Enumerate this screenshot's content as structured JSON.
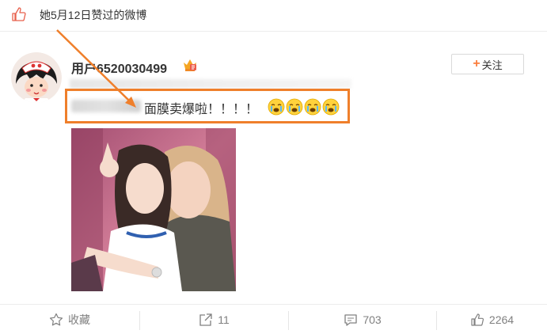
{
  "liked_notice": {
    "text": "她5月12日赞过的微博",
    "icon": "thumbs-up-icon"
  },
  "post": {
    "username": "用户6520030499",
    "badge_icon": "vip-crown-icon",
    "follow_label": "关注",
    "follow_icon": "plus-icon",
    "text": "面膜卖爆啦！！！！",
    "emoji_icons": [
      "crying-face-icon",
      "crying-face-icon",
      "crying-face-icon",
      "crying-face-icon"
    ],
    "highlight_color": "#ef7f2b"
  },
  "actions": {
    "favorite": {
      "label": "收藏",
      "icon": "star-icon"
    },
    "repost": {
      "count": "11",
      "icon": "share-icon"
    },
    "comment": {
      "count": "703",
      "icon": "comment-icon"
    },
    "like": {
      "count": "2264",
      "icon": "thumbs-up-icon"
    }
  },
  "colors": {
    "accent": "#fa7d3c",
    "annotation": "#ef7f2b",
    "text_gray": "#808080"
  }
}
